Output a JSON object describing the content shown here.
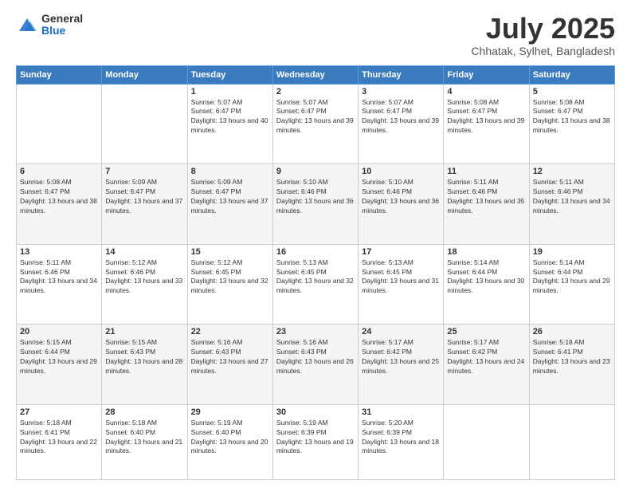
{
  "header": {
    "logo": {
      "general": "General",
      "blue": "Blue"
    },
    "title": "July 2025",
    "location": "Chhatak, Sylhet, Bangladesh"
  },
  "days_of_week": [
    "Sunday",
    "Monday",
    "Tuesday",
    "Wednesday",
    "Thursday",
    "Friday",
    "Saturday"
  ],
  "weeks": [
    [
      {
        "day": "",
        "info": ""
      },
      {
        "day": "",
        "info": ""
      },
      {
        "day": "1",
        "info": "Sunrise: 5:07 AM\nSunset: 6:47 PM\nDaylight: 13 hours and 40 minutes."
      },
      {
        "day": "2",
        "info": "Sunrise: 5:07 AM\nSunset: 6:47 PM\nDaylight: 13 hours and 39 minutes."
      },
      {
        "day": "3",
        "info": "Sunrise: 5:07 AM\nSunset: 6:47 PM\nDaylight: 13 hours and 39 minutes."
      },
      {
        "day": "4",
        "info": "Sunrise: 5:08 AM\nSunset: 6:47 PM\nDaylight: 13 hours and 39 minutes."
      },
      {
        "day": "5",
        "info": "Sunrise: 5:08 AM\nSunset: 6:47 PM\nDaylight: 13 hours and 38 minutes."
      }
    ],
    [
      {
        "day": "6",
        "info": "Sunrise: 5:08 AM\nSunset: 6:47 PM\nDaylight: 13 hours and 38 minutes."
      },
      {
        "day": "7",
        "info": "Sunrise: 5:09 AM\nSunset: 6:47 PM\nDaylight: 13 hours and 37 minutes."
      },
      {
        "day": "8",
        "info": "Sunrise: 5:09 AM\nSunset: 6:47 PM\nDaylight: 13 hours and 37 minutes."
      },
      {
        "day": "9",
        "info": "Sunrise: 5:10 AM\nSunset: 6:46 PM\nDaylight: 13 hours and 36 minutes."
      },
      {
        "day": "10",
        "info": "Sunrise: 5:10 AM\nSunset: 6:46 PM\nDaylight: 13 hours and 36 minutes."
      },
      {
        "day": "11",
        "info": "Sunrise: 5:11 AM\nSunset: 6:46 PM\nDaylight: 13 hours and 35 minutes."
      },
      {
        "day": "12",
        "info": "Sunrise: 5:11 AM\nSunset: 6:46 PM\nDaylight: 13 hours and 34 minutes."
      }
    ],
    [
      {
        "day": "13",
        "info": "Sunrise: 5:11 AM\nSunset: 6:46 PM\nDaylight: 13 hours and 34 minutes."
      },
      {
        "day": "14",
        "info": "Sunrise: 5:12 AM\nSunset: 6:46 PM\nDaylight: 13 hours and 33 minutes."
      },
      {
        "day": "15",
        "info": "Sunrise: 5:12 AM\nSunset: 6:45 PM\nDaylight: 13 hours and 32 minutes."
      },
      {
        "day": "16",
        "info": "Sunrise: 5:13 AM\nSunset: 6:45 PM\nDaylight: 13 hours and 32 minutes."
      },
      {
        "day": "17",
        "info": "Sunrise: 5:13 AM\nSunset: 6:45 PM\nDaylight: 13 hours and 31 minutes."
      },
      {
        "day": "18",
        "info": "Sunrise: 5:14 AM\nSunset: 6:44 PM\nDaylight: 13 hours and 30 minutes."
      },
      {
        "day": "19",
        "info": "Sunrise: 5:14 AM\nSunset: 6:44 PM\nDaylight: 13 hours and 29 minutes."
      }
    ],
    [
      {
        "day": "20",
        "info": "Sunrise: 5:15 AM\nSunset: 6:44 PM\nDaylight: 13 hours and 29 minutes."
      },
      {
        "day": "21",
        "info": "Sunrise: 5:15 AM\nSunset: 6:43 PM\nDaylight: 13 hours and 28 minutes."
      },
      {
        "day": "22",
        "info": "Sunrise: 5:16 AM\nSunset: 6:43 PM\nDaylight: 13 hours and 27 minutes."
      },
      {
        "day": "23",
        "info": "Sunrise: 5:16 AM\nSunset: 6:43 PM\nDaylight: 13 hours and 26 minutes."
      },
      {
        "day": "24",
        "info": "Sunrise: 5:17 AM\nSunset: 6:42 PM\nDaylight: 13 hours and 25 minutes."
      },
      {
        "day": "25",
        "info": "Sunrise: 5:17 AM\nSunset: 6:42 PM\nDaylight: 13 hours and 24 minutes."
      },
      {
        "day": "26",
        "info": "Sunrise: 5:18 AM\nSunset: 6:41 PM\nDaylight: 13 hours and 23 minutes."
      }
    ],
    [
      {
        "day": "27",
        "info": "Sunrise: 5:18 AM\nSunset: 6:41 PM\nDaylight: 13 hours and 22 minutes."
      },
      {
        "day": "28",
        "info": "Sunrise: 5:18 AM\nSunset: 6:40 PM\nDaylight: 13 hours and 21 minutes."
      },
      {
        "day": "29",
        "info": "Sunrise: 5:19 AM\nSunset: 6:40 PM\nDaylight: 13 hours and 20 minutes."
      },
      {
        "day": "30",
        "info": "Sunrise: 5:19 AM\nSunset: 6:39 PM\nDaylight: 13 hours and 19 minutes."
      },
      {
        "day": "31",
        "info": "Sunrise: 5:20 AM\nSunset: 6:39 PM\nDaylight: 13 hours and 18 minutes."
      },
      {
        "day": "",
        "info": ""
      },
      {
        "day": "",
        "info": ""
      }
    ]
  ]
}
